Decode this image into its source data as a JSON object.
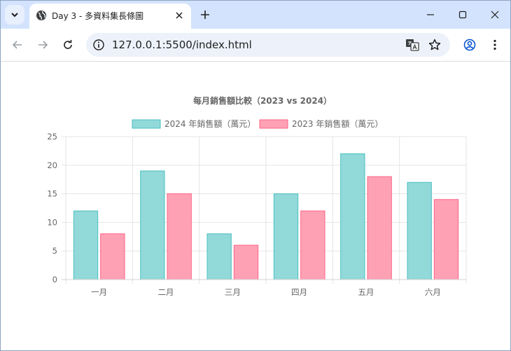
{
  "browser": {
    "tab": {
      "title": "Day 3 - 多資料集長條圖"
    },
    "url": "127.0.0.1:5500/index.html"
  },
  "colors": {
    "series2024_fill": "#92d9d9",
    "series2024_stroke": "#4bc0c0",
    "series2023_fill": "#ffa1b5",
    "series2023_stroke": "#ff6384",
    "grid": "#e5e5e5",
    "text": "#666666"
  },
  "chart_data": {
    "type": "bar",
    "title": "每月銷售額比較（2023 vs 2024）",
    "categories": [
      "一月",
      "二月",
      "三月",
      "四月",
      "五月",
      "六月"
    ],
    "series": [
      {
        "name": "2024 年銷售額（萬元）",
        "values": [
          12,
          19,
          8,
          15,
          22,
          17
        ]
      },
      {
        "name": "2023 年銷售額（萬元）",
        "values": [
          8,
          15,
          6,
          12,
          18,
          14
        ]
      }
    ],
    "ylim": [
      0,
      25
    ],
    "yticks": [
      "0",
      "5",
      "10",
      "15",
      "20",
      "25"
    ],
    "legend": "top",
    "grid": true
  }
}
